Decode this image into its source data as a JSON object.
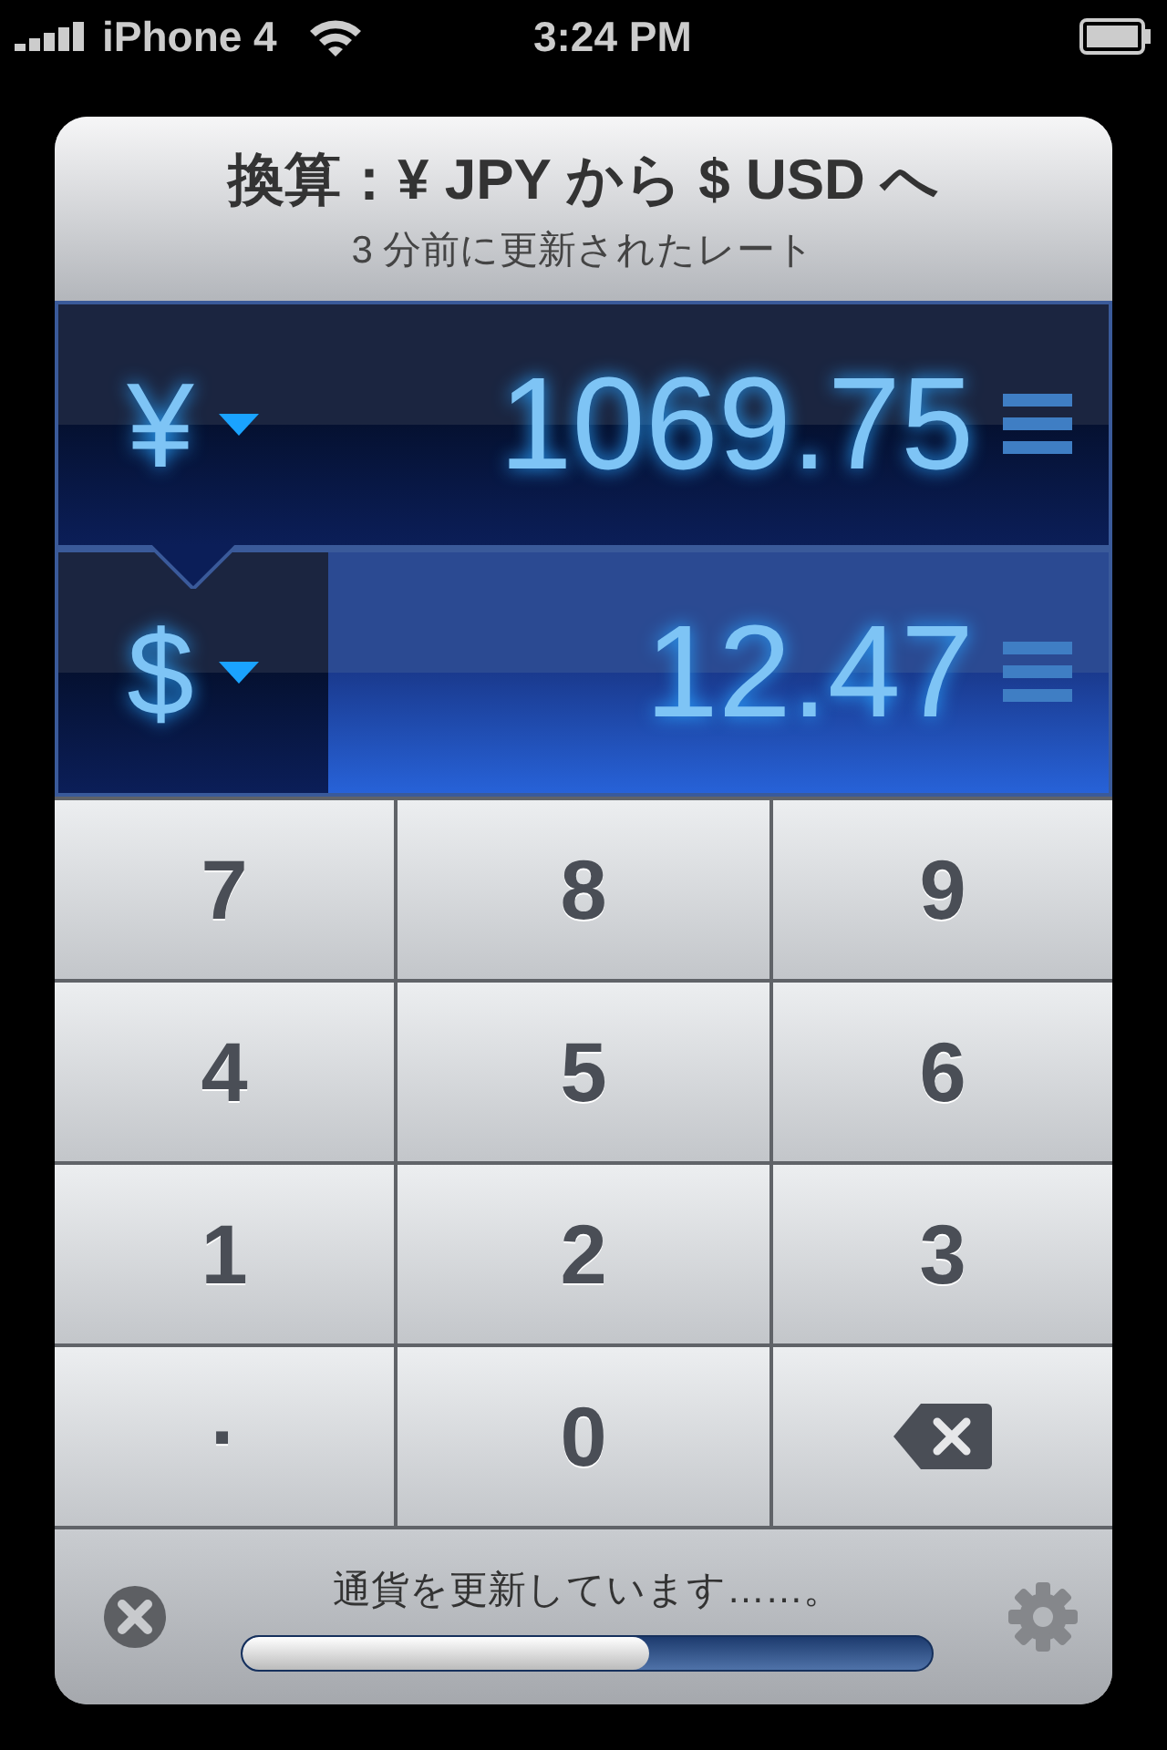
{
  "status_bar": {
    "carrier": "iPhone 4",
    "time": "3:24 PM"
  },
  "header": {
    "title": "換算：¥ JPY から $ USD へ",
    "subtitle": "3 分前に更新されたレート"
  },
  "currencies": [
    {
      "symbol": "¥",
      "amount": "1069.75",
      "selected": false
    },
    {
      "symbol": "$",
      "amount": "12.47",
      "selected": true
    }
  ],
  "keypad": [
    {
      "kind": "digit",
      "label": "7"
    },
    {
      "kind": "digit",
      "label": "8"
    },
    {
      "kind": "digit",
      "label": "9"
    },
    {
      "kind": "digit",
      "label": "4"
    },
    {
      "kind": "digit",
      "label": "5"
    },
    {
      "kind": "digit",
      "label": "6"
    },
    {
      "kind": "digit",
      "label": "1"
    },
    {
      "kind": "digit",
      "label": "2"
    },
    {
      "kind": "digit",
      "label": "3"
    },
    {
      "kind": "digit",
      "label": "·"
    },
    {
      "kind": "digit",
      "label": "0"
    },
    {
      "kind": "backspace"
    }
  ],
  "footer": {
    "message": "通貨を更新しています……。",
    "level": 0.59
  }
}
